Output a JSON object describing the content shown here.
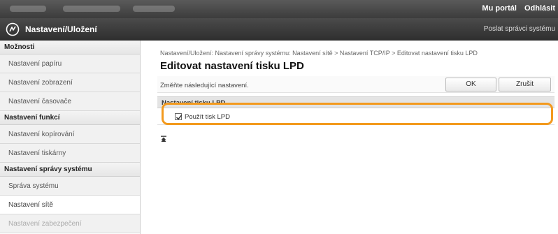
{
  "topbar": {
    "links": [
      "Mu portál",
      "Odhlásit"
    ]
  },
  "header": {
    "title": "Nastavení/Uložení",
    "right_link": "Poslat správci systému"
  },
  "sidebar": {
    "sections": [
      {
        "heading": "Možnosti",
        "items": [
          {
            "label": "Nastavení papíru"
          },
          {
            "label": "Nastavení zobrazení"
          },
          {
            "label": "Nastavení časovače"
          }
        ]
      },
      {
        "heading": "Nastavení funkcí",
        "items": [
          {
            "label": "Nastavení kopírování"
          },
          {
            "label": "Nastavení tiskárny"
          }
        ]
      },
      {
        "heading": "Nastavení správy systému",
        "items": [
          {
            "label": "Správa systému"
          },
          {
            "label": "Nastavení sítě"
          },
          {
            "label": "Nastavení zabezpečení"
          }
        ]
      }
    ]
  },
  "main": {
    "breadcrumb": "Nastavení/Uložení: Nastavení správy systému: Nastavení sítě > Nastavení TCP/IP > Editovat nastavení tisku LPD",
    "title": "Editovat nastavení tisku LPD",
    "instruction": "Změňte následující nastavení.",
    "ok_label": "OK",
    "cancel_label": "Zrušit",
    "section_title": "Nastavení tisku LPD",
    "option_label": "Použít tisk LPD",
    "option_checked": true,
    "highlight_color": "#f39a1e"
  }
}
